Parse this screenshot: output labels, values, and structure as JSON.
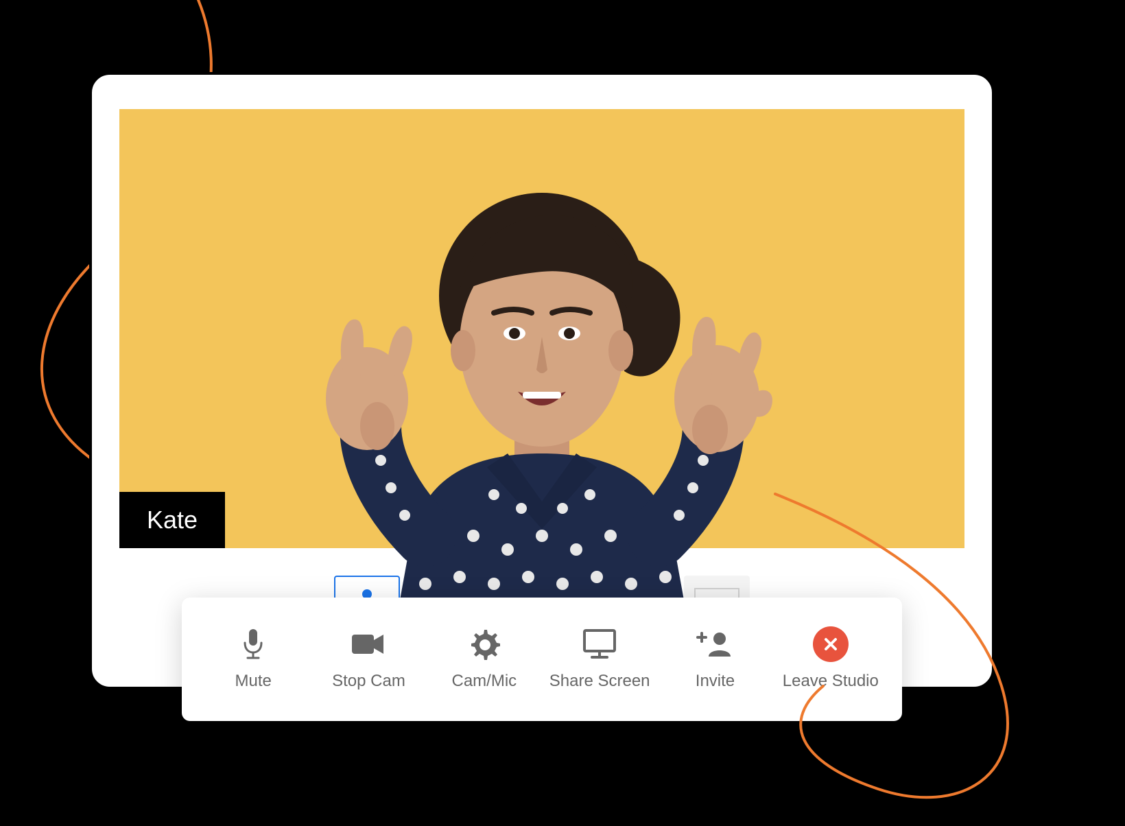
{
  "video": {
    "participant_name": "Kate",
    "background_color": "#f3c55a"
  },
  "layouts": {
    "options": [
      {
        "id": "single",
        "active": true,
        "icon": "person-1"
      },
      {
        "id": "two",
        "active": false,
        "icon": "person-2"
      },
      {
        "id": "three",
        "active": false,
        "icon": "person-3"
      },
      {
        "id": "screen-small",
        "active": false,
        "icon": "screen-pip"
      },
      {
        "id": "screen-side",
        "active": false,
        "icon": "screen-side"
      },
      {
        "id": "screen-full",
        "active": false,
        "icon": "screen-full"
      }
    ]
  },
  "toolbar": {
    "mute_label": "Mute",
    "stopcam_label": "Stop Cam",
    "cammic_label": "Cam/Mic",
    "share_label": "Share Screen",
    "invite_label": "Invite",
    "leave_label": "Leave Studio"
  },
  "colors": {
    "accent_blue": "#1a73e8",
    "leave_red": "#e8533d",
    "icon_grey": "#666666",
    "swirl_orange": "#ee7a2e"
  }
}
